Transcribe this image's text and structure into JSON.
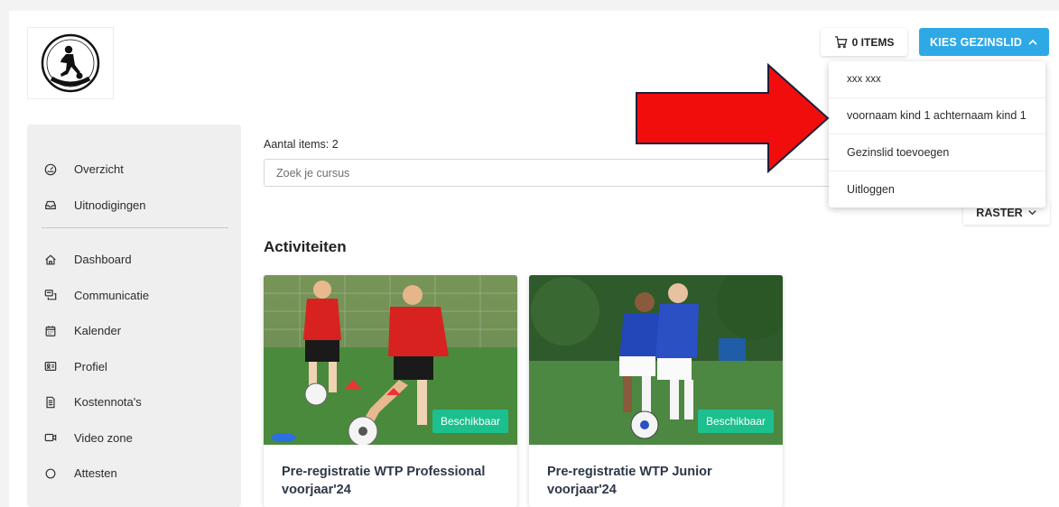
{
  "header": {
    "cart_label": "0 ITEMS",
    "member_button_label": "KIES GEZINSLID"
  },
  "member_menu": {
    "items": [
      {
        "label": "xxx xxx"
      },
      {
        "label": "voornaam kind 1 achternaam kind 1"
      },
      {
        "label": "Gezinslid toevoegen"
      },
      {
        "label": "Uitloggen"
      }
    ]
  },
  "logo": {
    "alt_text": "WAY TO PLAY",
    "icon": "soccer-player-logo"
  },
  "sidebar": {
    "top_items": [
      {
        "label": "Overzicht",
        "icon": "gauge-icon"
      },
      {
        "label": "Uitnodigingen",
        "icon": "inbox-icon"
      }
    ],
    "items": [
      {
        "label": "Dashboard",
        "icon": "home-icon"
      },
      {
        "label": "Communicatie",
        "icon": "chat-icon"
      },
      {
        "label": "Kalender",
        "icon": "calendar-icon"
      },
      {
        "label": "Profiel",
        "icon": "id-card-icon"
      },
      {
        "label": "Kostennota's",
        "icon": "document-icon"
      },
      {
        "label": "Video zone",
        "icon": "video-icon"
      },
      {
        "label": "Attesten",
        "icon": "circle-icon"
      }
    ]
  },
  "main": {
    "items_count_label": "Aantal items: 2",
    "search_placeholder": "Zoek je cursus",
    "view_toggle_label": "RASTER",
    "section_title": "Activiteiten",
    "cards": [
      {
        "title": "Pre-registratie WTP Professional voorjaar'24",
        "badge": "Beschikbaar"
      },
      {
        "title": "Pre-registratie WTP Junior voorjaar'24",
        "badge": "Beschikbaar"
      }
    ]
  },
  "colors": {
    "accent": "#2fa9e6",
    "badge": "#1cbf8e",
    "arrow": "#f20d0d",
    "sidebar_bg": "#efefef"
  }
}
